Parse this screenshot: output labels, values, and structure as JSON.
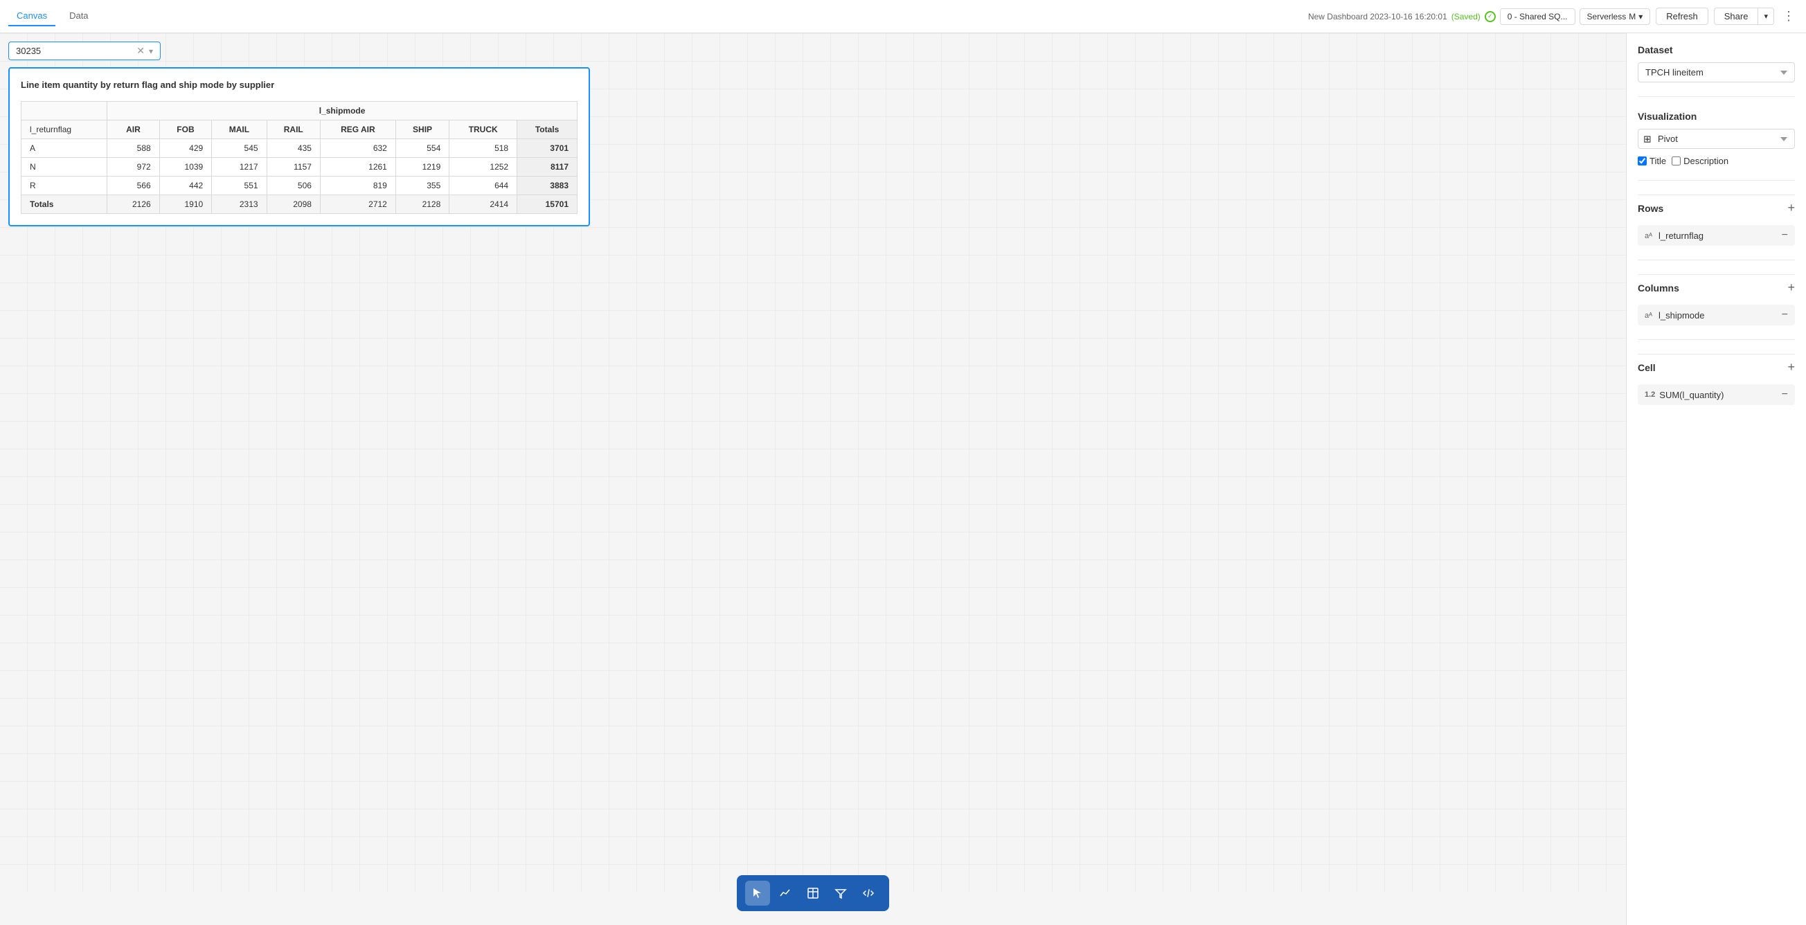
{
  "nav": {
    "tabs": [
      {
        "label": "Canvas",
        "active": true
      },
      {
        "label": "Data",
        "active": false
      }
    ],
    "dashboard_title": "New Dashboard 2023-10-16 16:20:01",
    "saved_label": "(Saved)",
    "status_icon": "check",
    "connection": "0 - Shared SQ...",
    "engine": "Serverless",
    "engine_size": "M",
    "refresh_label": "Refresh",
    "share_label": "Share",
    "more_icon": "⋮"
  },
  "filter": {
    "value": "30235",
    "clear_icon": "✕",
    "dropdown_icon": "▾"
  },
  "chart": {
    "title": "Line item quantity by return flag and ship mode by supplier",
    "shipmode_header": "l_shipmode",
    "returnflag_header": "l_returnflag",
    "columns": [
      "AIR",
      "FOB",
      "MAIL",
      "RAIL",
      "REG AIR",
      "SHIP",
      "TRUCK",
      "Totals"
    ],
    "rows": [
      {
        "flag": "A",
        "values": [
          588,
          429,
          545,
          435,
          632,
          554,
          518,
          3701
        ]
      },
      {
        "flag": "N",
        "values": [
          972,
          1039,
          1217,
          1157,
          1261,
          1219,
          1252,
          8117
        ]
      },
      {
        "flag": "R",
        "values": [
          566,
          442,
          551,
          506,
          819,
          355,
          644,
          3883
        ]
      }
    ],
    "totals": {
      "label": "Totals",
      "values": [
        2126,
        1910,
        2313,
        2098,
        2712,
        2128,
        2414,
        15701
      ]
    }
  },
  "toolbar": {
    "buttons": [
      {
        "name": "select",
        "icon": "✦",
        "active": true
      },
      {
        "name": "chart",
        "icon": "📈",
        "active": false
      },
      {
        "name": "table",
        "icon": "⊞",
        "active": false
      },
      {
        "name": "filter",
        "icon": "⊿",
        "active": false
      },
      {
        "name": "code",
        "icon": "{}",
        "active": false
      }
    ]
  },
  "right_panel": {
    "dataset_label": "Dataset",
    "dataset_value": "TPCH lineitem",
    "visualization_label": "Visualization",
    "viz_type": "Pivot",
    "title_label": "Title",
    "description_label": "Description",
    "title_checked": true,
    "description_checked": false,
    "rows_label": "Rows",
    "rows_item": "l_returnflag",
    "columns_label": "Columns",
    "columns_item": "l_shipmode",
    "cell_label": "Cell",
    "cell_formula_badge": "1.2",
    "cell_formula": "SUM(l_quantity)"
  }
}
